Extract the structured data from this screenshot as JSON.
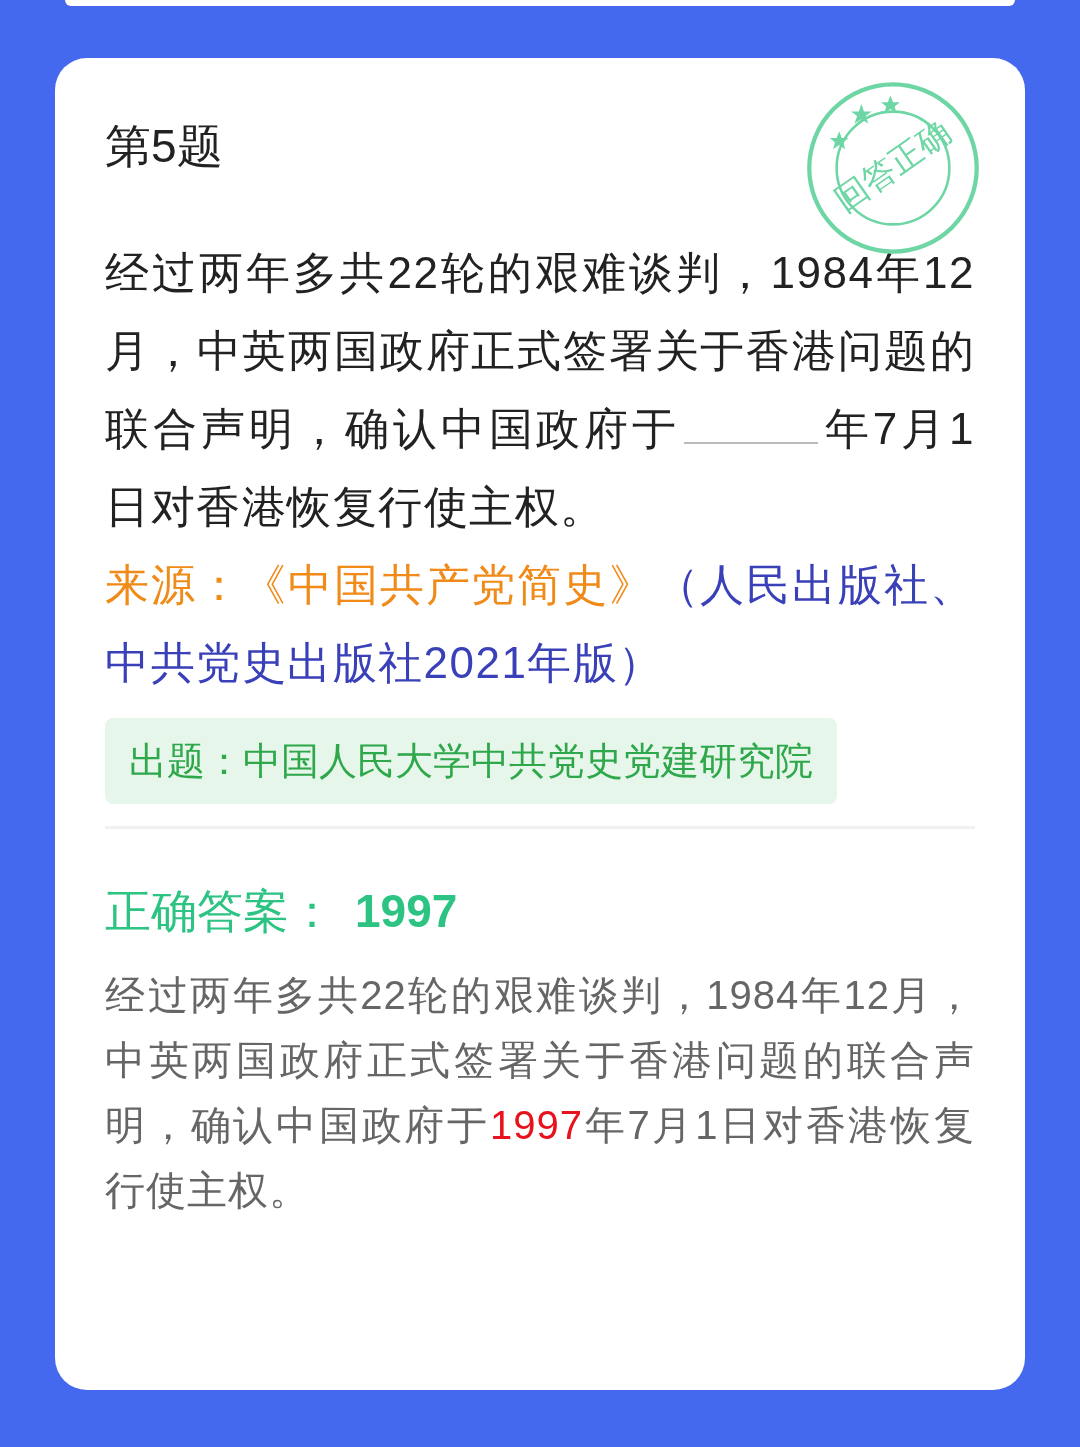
{
  "question": {
    "number_label": "第5题",
    "text_before": "经过两年多共22轮的艰难谈判，1984年12月，中英两国政府正式签署关于香港问题的联合声明，确认中国政府于",
    "text_after": "年7月1日对香港恢复行使主权。"
  },
  "stamp": {
    "text": "回答正确"
  },
  "source": {
    "label": "来源：",
    "book": "《中国共产党简史》",
    "publisher": "（人民出版社、中共党史出版社2021年版）"
  },
  "author_tag": "出题：中国人民大学中共党史党建研究院",
  "answer": {
    "label": "正确答案：",
    "value": "1997"
  },
  "explanation": {
    "before": "经过两年多共22轮的艰难谈判，1984年12月，中英两国政府正式签署关于香港问题的联合声明，确认中国政府于",
    "highlight": "1997",
    "after": "年7月1日对香港恢复行使主权。"
  }
}
